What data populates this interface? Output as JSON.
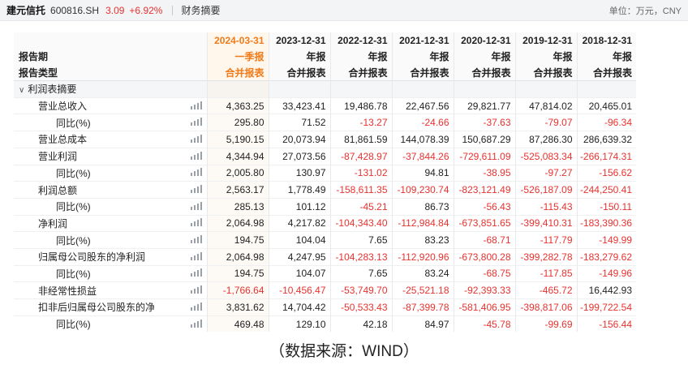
{
  "header": {
    "name": "建元信托",
    "code": "600816.SH",
    "price": "3.09",
    "change": "+6.92%",
    "section": "财务摘要",
    "unit": "单位：万元，CNY"
  },
  "table": {
    "row_labels": [
      "报告期",
      "报告类型",
      "",
      "利润表摘要"
    ],
    "dates": [
      "2024-03-31",
      "2023-12-31",
      "2022-12-31",
      "2021-12-31",
      "2020-12-31",
      "2019-12-31",
      "2018-12-31"
    ],
    "periods": [
      "一季报",
      "年报",
      "年报",
      "年报",
      "年报",
      "年报",
      "年报"
    ],
    "types": [
      "合并报表",
      "合并报表",
      "合并报表",
      "合并报表",
      "合并报表",
      "合并报表",
      "合并报表"
    ],
    "section_title": "利润表摘要",
    "rows": [
      {
        "label": "营业总收入",
        "level": 1,
        "values": [
          "4,363.25",
          "33,423.41",
          "19,486.78",
          "22,467.56",
          "29,821.77",
          "47,814.02",
          "20,465.01"
        ]
      },
      {
        "label": "同比(%)",
        "level": 2,
        "values": [
          "295.80",
          "71.52",
          "-13.27",
          "-24.66",
          "-37.63",
          "-79.07",
          "-96.34"
        ]
      },
      {
        "label": "营业总成本",
        "level": 1,
        "values": [
          "5,190.15",
          "20,073.94",
          "81,861.59",
          "144,078.39",
          "150,687.29",
          "87,286.30",
          "286,639.32"
        ]
      },
      {
        "label": "营业利润",
        "level": 1,
        "values": [
          "4,344.94",
          "27,073.56",
          "-87,428.97",
          "-37,844.26",
          "-729,611.09",
          "-525,083.34",
          "-266,174.31"
        ]
      },
      {
        "label": "同比(%)",
        "level": 2,
        "values": [
          "2,005.80",
          "130.97",
          "-131.02",
          "94.81",
          "-38.95",
          "-97.27",
          "-156.62"
        ]
      },
      {
        "label": "利润总额",
        "level": 1,
        "values": [
          "2,563.17",
          "1,778.49",
          "-158,611.35",
          "-109,230.74",
          "-823,121.49",
          "-526,187.09",
          "-244,250.41"
        ]
      },
      {
        "label": "同比(%)",
        "level": 2,
        "values": [
          "285.13",
          "101.12",
          "-45.21",
          "86.73",
          "-56.43",
          "-115.43",
          "-150.11"
        ]
      },
      {
        "label": "净利润",
        "level": 1,
        "values": [
          "2,064.98",
          "4,217.82",
          "-104,343.40",
          "-112,984.84",
          "-673,851.65",
          "-399,410.31",
          "-183,390.36"
        ]
      },
      {
        "label": "同比(%)",
        "level": 2,
        "values": [
          "194.75",
          "104.04",
          "7.65",
          "83.23",
          "-68.71",
          "-117.79",
          "-149.99"
        ]
      },
      {
        "label": "归属母公司股东的净利润",
        "level": 1,
        "values": [
          "2,064.98",
          "4,247.95",
          "-104,283.13",
          "-112,920.96",
          "-673,800.28",
          "-399,282.78",
          "-183,279.62"
        ]
      },
      {
        "label": "同比(%)",
        "level": 2,
        "values": [
          "194.75",
          "104.07",
          "7.65",
          "83.24",
          "-68.75",
          "-117.85",
          "-149.96"
        ]
      },
      {
        "label": "非经常性损益",
        "level": 1,
        "values": [
          "-1,766.64",
          "-10,456.47",
          "-53,749.70",
          "-25,521.18",
          "-92,393.33",
          "-465.72",
          "16,442.93"
        ]
      },
      {
        "label": "扣非后归属母公司股东的净利润",
        "level": 1,
        "values": [
          "3,831.62",
          "14,704.42",
          "-50,533.43",
          "-87,399.78",
          "-581,406.95",
          "-398,817.06",
          "-199,722.54"
        ]
      },
      {
        "label": "同比(%)",
        "level": 2,
        "values": [
          "469.48",
          "129.10",
          "42.18",
          "84.97",
          "-45.78",
          "-99.69",
          "-156.44"
        ]
      }
    ]
  },
  "source": "（数据来源：WIND）",
  "colors": {
    "negative": "#e8322f",
    "accent": "#f07b1a",
    "band": "#f5f6f8"
  },
  "icons": {
    "row_action": "bar-chart-icon",
    "expand": "chevron-down-icon"
  }
}
